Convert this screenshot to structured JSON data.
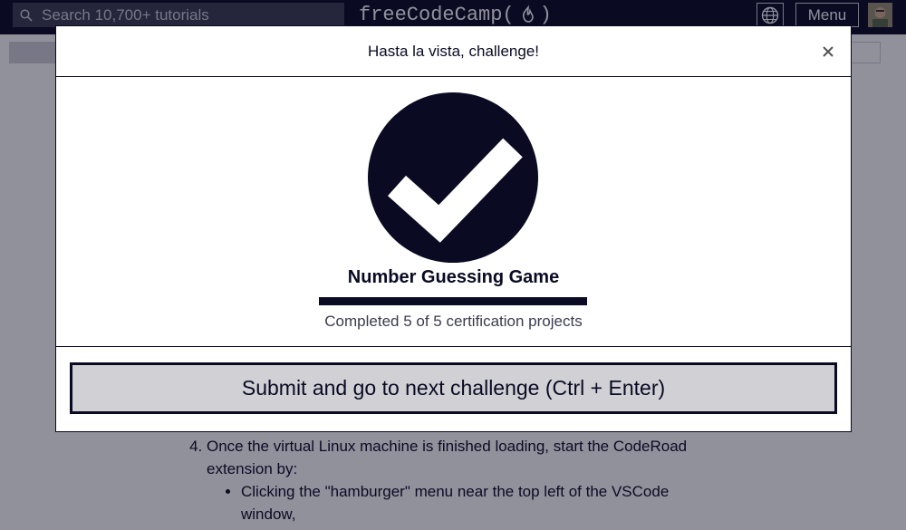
{
  "navbar": {
    "search": {
      "placeholder": "Search 10,700+ tutorials",
      "icon": "search-icon"
    },
    "logo_text": "freeCodeCamp(",
    "logo_close": ")",
    "language_icon": "globe-icon",
    "menu_label": "Menu"
  },
  "modal": {
    "title": "Hasta la vista, challenge!",
    "close_icon": "close-icon",
    "project_title": "Number Guessing Game",
    "progress": {
      "completed": 5,
      "total": 5,
      "text": "Completed 5 of 5 certification projects"
    },
    "submit_label": "Submit and go to next challenge (Ctrl + Enter)"
  },
  "background": {
    "step_number": "4.",
    "step_text": "Once the virtual Linux machine is finished loading, start the CodeRoad extension by:",
    "bullet_text": "Clicking the \"hamburger\" menu near the top left of the VSCode window,"
  },
  "colors": {
    "nav_bg": "#0a0a23",
    "overlay": "#0a0a23",
    "button_bg": "#d0d0d5",
    "text": "#0a0a23"
  }
}
